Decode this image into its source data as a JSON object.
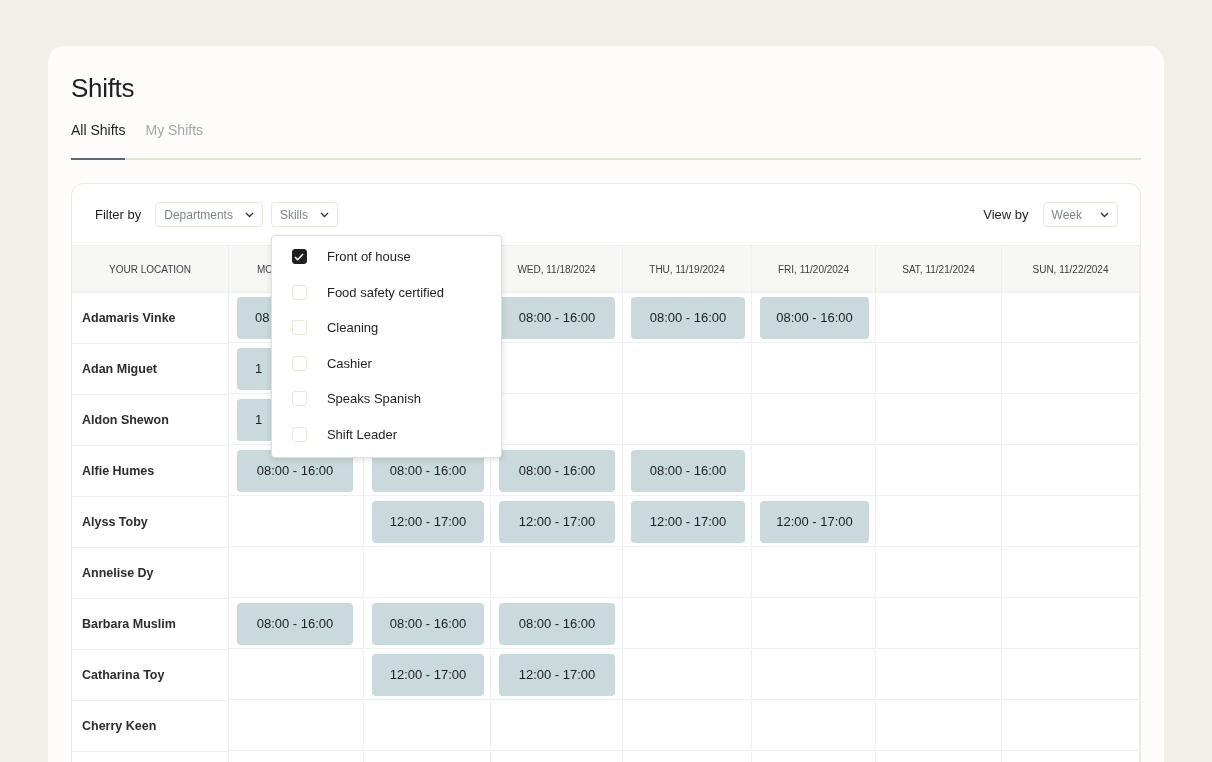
{
  "title": "Shifts",
  "tabs": [
    {
      "label": "All Shifts",
      "selected": true
    },
    {
      "label": "My Shifts",
      "selected": false
    }
  ],
  "filter_bar": {
    "filter_label": "Filter by",
    "filters": [
      {
        "placeholder": "Departments"
      },
      {
        "placeholder": "Skills",
        "options": [
          {
            "label": "Front of house",
            "checked": true
          },
          {
            "label": "Food safety certified",
            "checked": false
          },
          {
            "label": "Cleaning",
            "checked": false
          },
          {
            "label": "Cashier",
            "checked": false
          },
          {
            "label": "Speaks Spanish",
            "checked": false
          },
          {
            "label": "Shift Leader",
            "checked": false
          }
        ]
      }
    ],
    "view_label": "View by",
    "view": {
      "placeholder": "Week"
    }
  },
  "table": {
    "columns": [
      {
        "label": "YOUR LOCATION"
      },
      {
        "label": "MO",
        "partial": true
      },
      {},
      {
        "label": "WED, 11/18/2024"
      },
      {
        "label": "THU, 11/19/2024"
      },
      {
        "label": "FRI, 11/20/2024"
      },
      {
        "label": "SAT, 11/21/2024"
      },
      {
        "label": "SUN, 11/22/2024"
      }
    ],
    "rows": [
      {
        "cells": [
          "Adamaris Vinke",
          {
            "time": "08",
            "partial": true
          },
          null,
          {
            "time": "08:00 - 16:00"
          },
          {
            "time": "08:00 - 16:00"
          },
          {
            "time": "08:00 - 16:00"
          },
          "",
          ""
        ]
      },
      {
        "cells": [
          "Adan Miguet",
          {
            "time": "1",
            "partial": true
          },
          null,
          "",
          "",
          "",
          "",
          ""
        ]
      },
      {
        "cells": [
          "Aldon Shewon",
          {
            "time": "1",
            "partial": true
          },
          null,
          "",
          "",
          "",
          "",
          ""
        ]
      },
      {
        "cells": [
          "Alfie Humes",
          {
            "time": "08:00 - 16:00"
          },
          {
            "time": "08:00 - 16:00"
          },
          {
            "time": "08:00 - 16:00"
          },
          {
            "time": "08:00 - 16:00"
          },
          "",
          "",
          ""
        ]
      },
      {
        "cells": [
          "Alyss Toby",
          "",
          {
            "time": "12:00 - 17:00"
          },
          {
            "time": "12:00 - 17:00"
          },
          {
            "time": "12:00 - 17:00"
          },
          {
            "time": "12:00 - 17:00"
          },
          "",
          ""
        ]
      },
      {
        "cells": [
          "Annelise Dy",
          "",
          "",
          "",
          "",
          "",
          "",
          ""
        ]
      },
      {
        "cells": [
          "Barbara Muslim",
          {
            "time": "08:00 - 16:00"
          },
          {
            "time": "08:00 - 16:00"
          },
          {
            "time": "08:00 - 16:00"
          },
          "",
          "",
          "",
          ""
        ]
      },
      {
        "cells": [
          "Catharina Toy",
          "",
          {
            "time": "12:00 - 17:00"
          },
          {
            "time": "12:00 - 17:00"
          },
          "",
          "",
          "",
          ""
        ]
      },
      {
        "cells": [
          "Cherry Keen",
          "",
          "",
          "",
          "",
          "",
          "",
          ""
        ]
      }
    ]
  }
}
